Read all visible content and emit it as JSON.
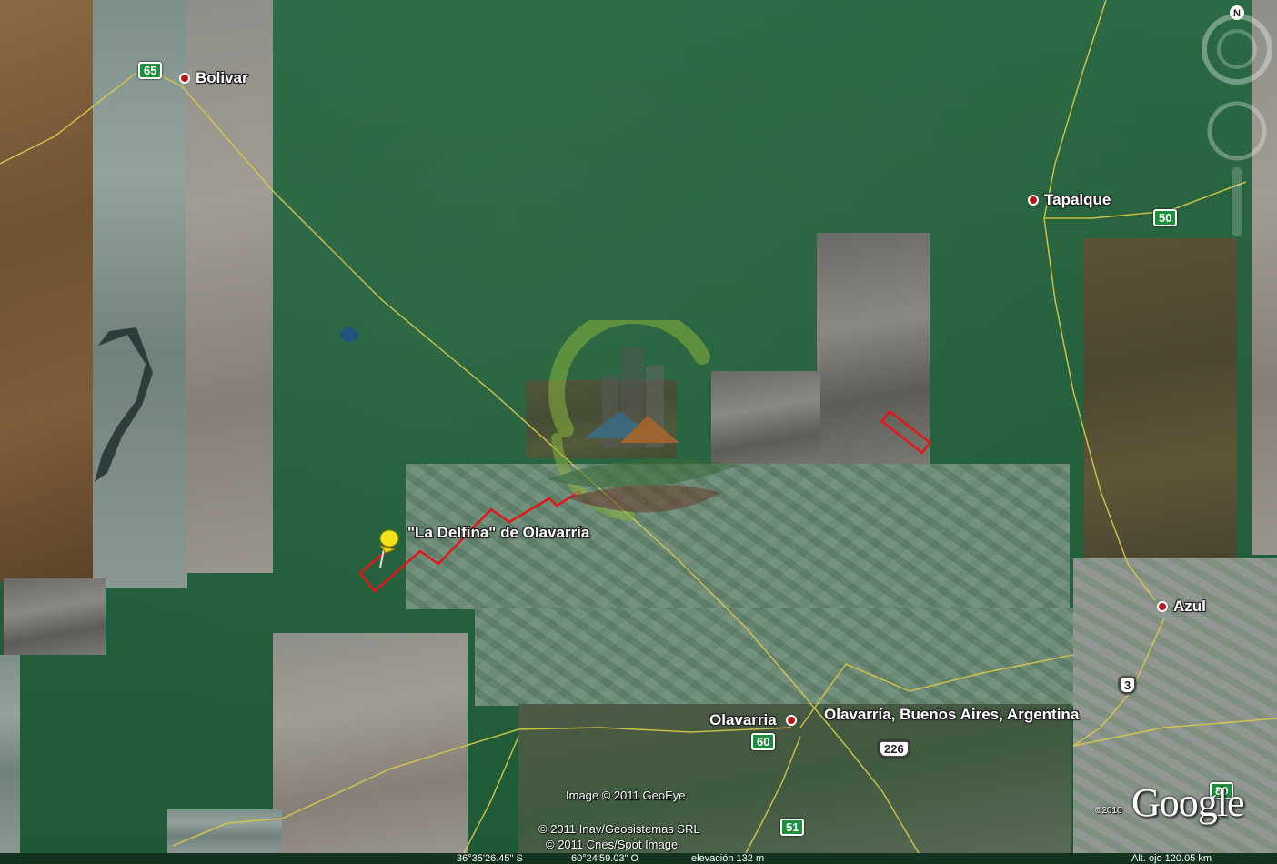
{
  "map": {
    "type": "satellite",
    "provider": "Google",
    "places": [
      {
        "id": "bolivar",
        "name": "Bolivar"
      },
      {
        "id": "tapalque",
        "name": "Tapalque"
      },
      {
        "id": "azul",
        "name": "Azul"
      },
      {
        "id": "olavarria",
        "name": "Olavarria"
      }
    ],
    "search_result": "Olavarría, Buenos Aires, Argentina",
    "placemark": "\"La Delfina\" de Olavarría",
    "routes": [
      "65",
      "50",
      "3",
      "60",
      "226",
      "51",
      "80"
    ],
    "credits": {
      "image": "Image © 2011 GeoEye",
      "inav": "© 2011 Inav/Geosistemas SRL",
      "cnes": "© 2011 Cnes/Spot Image",
      "copyright_year": "©2010"
    },
    "status": {
      "lat": "36°35'26.45\" S",
      "lon": "60°24'59.03\" O",
      "elevation": "elevación 132 m",
      "altitude": "Alt. ojo 120.05 km"
    },
    "compass": "N",
    "colors": {
      "parcel_outline": "#e01818",
      "road": "#d8c94a",
      "pin": "#f3e21a",
      "route_shield": "#1d8f3a"
    }
  }
}
